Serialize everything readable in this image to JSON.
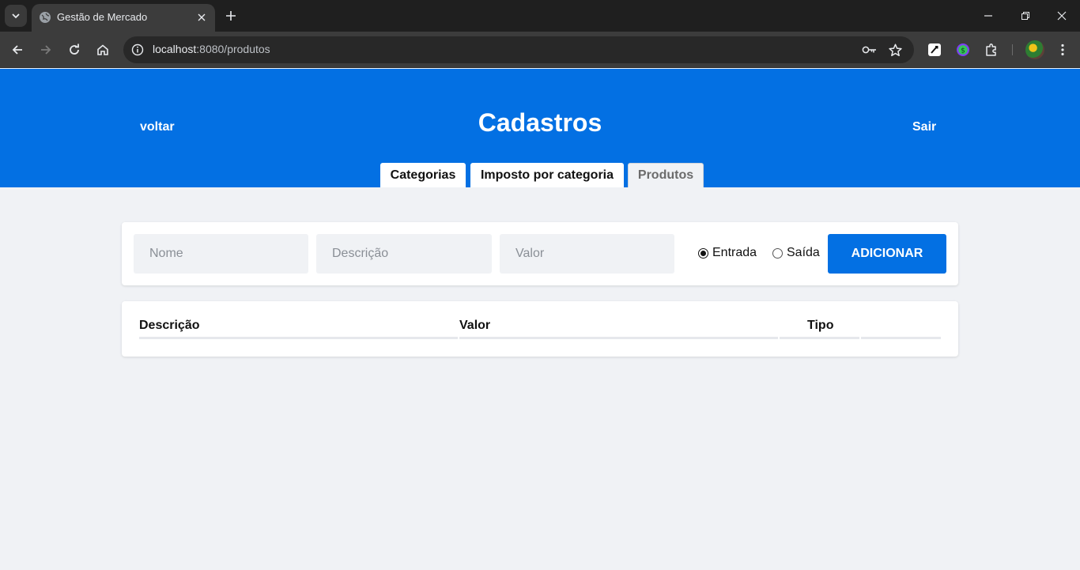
{
  "browser": {
    "tab_title": "Gestão de Mercado",
    "url_host": "localhost",
    "url_rest": ":8080/produtos"
  },
  "header": {
    "back_label": "voltar",
    "title": "Cadastros",
    "logout_label": "Sair",
    "tabs": [
      {
        "label": "Categorias",
        "active": false
      },
      {
        "label": "Imposto por categoria",
        "active": false
      },
      {
        "label": "Produtos",
        "active": true
      }
    ]
  },
  "form": {
    "nome_placeholder": "Nome",
    "descricao_placeholder": "Descrição",
    "valor_placeholder": "Valor",
    "radio_entrada": "Entrada",
    "radio_saida": "Saída",
    "selected_type": "Entrada",
    "add_button": "ADICIONAR"
  },
  "table": {
    "columns": [
      "Descrição",
      "Valor",
      "Tipo",
      ""
    ],
    "rows": []
  },
  "colors": {
    "primary": "#0370e3",
    "page_bg": "#f0f2f5"
  }
}
